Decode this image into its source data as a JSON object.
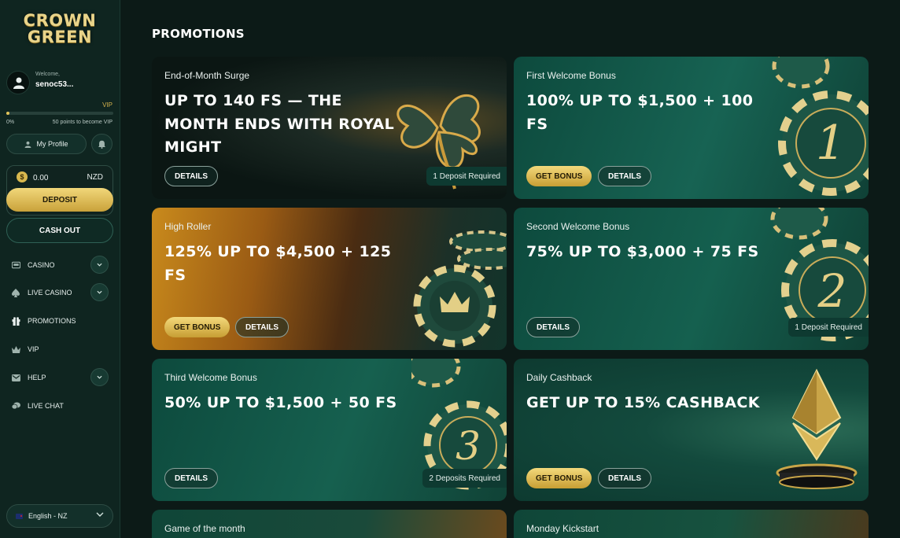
{
  "brand": {
    "line1": "CROWN",
    "line2": "GREEN"
  },
  "user": {
    "welcome": "Welcome,",
    "name": "senoc53...",
    "vip_label": "VIP",
    "progress_percent": 0,
    "progress_text": "0%",
    "points_note": "50 points to become VIP"
  },
  "sidebar": {
    "profile_label": "My Profile",
    "balance": "0.00",
    "currency": "NZD",
    "coin_symbol": "$",
    "deposit_label": "DEPOSIT",
    "cashout_label": "CASH OUT",
    "nav": [
      {
        "label": "CASINO",
        "icon": "slot-machine-icon",
        "has_toggle": true
      },
      {
        "label": "LIVE CASINO",
        "icon": "spade-icon",
        "has_toggle": true
      },
      {
        "label": "PROMOTIONS",
        "icon": "gift-icon",
        "has_toggle": false
      },
      {
        "label": "VIP",
        "icon": "crown-icon",
        "has_toggle": false
      },
      {
        "label": "HELP",
        "icon": "message-icon",
        "has_toggle": true
      },
      {
        "label": "LIVE CHAT",
        "icon": "chat-icon",
        "has_toggle": false
      }
    ],
    "language": "English - NZ"
  },
  "main": {
    "title": "PROMOTIONS",
    "cards": [
      {
        "subtitle": "End-of-Month Surge",
        "headline": "UP TO 140 FS — THE MONTH ENDS WITH ROYAL MIGHT",
        "details_label": "DETAILS",
        "requirement": "1 Deposit Required"
      },
      {
        "subtitle": "First Welcome Bonus",
        "headline": "100% UP TO $1,500 + 100 FS",
        "bonus_label": "GET BONUS",
        "details_label": "DETAILS",
        "chip_number": "1"
      },
      {
        "subtitle": "High Roller",
        "headline": "125% UP TO $4,500 + 125 FS",
        "bonus_label": "GET BONUS",
        "details_label": "DETAILS"
      },
      {
        "subtitle": "Second Welcome Bonus",
        "headline": "75% UP TO $3,000 + 75 FS",
        "details_label": "DETAILS",
        "requirement": "1 Deposit Required",
        "chip_number": "2"
      },
      {
        "subtitle": "Third Welcome Bonus",
        "headline": "50% UP TO $1,500 + 50 FS",
        "details_label": "DETAILS",
        "requirement": "2 Deposits Required",
        "chip_number": "3"
      },
      {
        "subtitle": "Daily Cashback",
        "headline": "GET UP TO 15% CASHBACK",
        "bonus_label": "GET BONUS",
        "details_label": "DETAILS"
      },
      {
        "subtitle": "Game of the month"
      },
      {
        "subtitle": "Monday Kickstart"
      }
    ]
  }
}
